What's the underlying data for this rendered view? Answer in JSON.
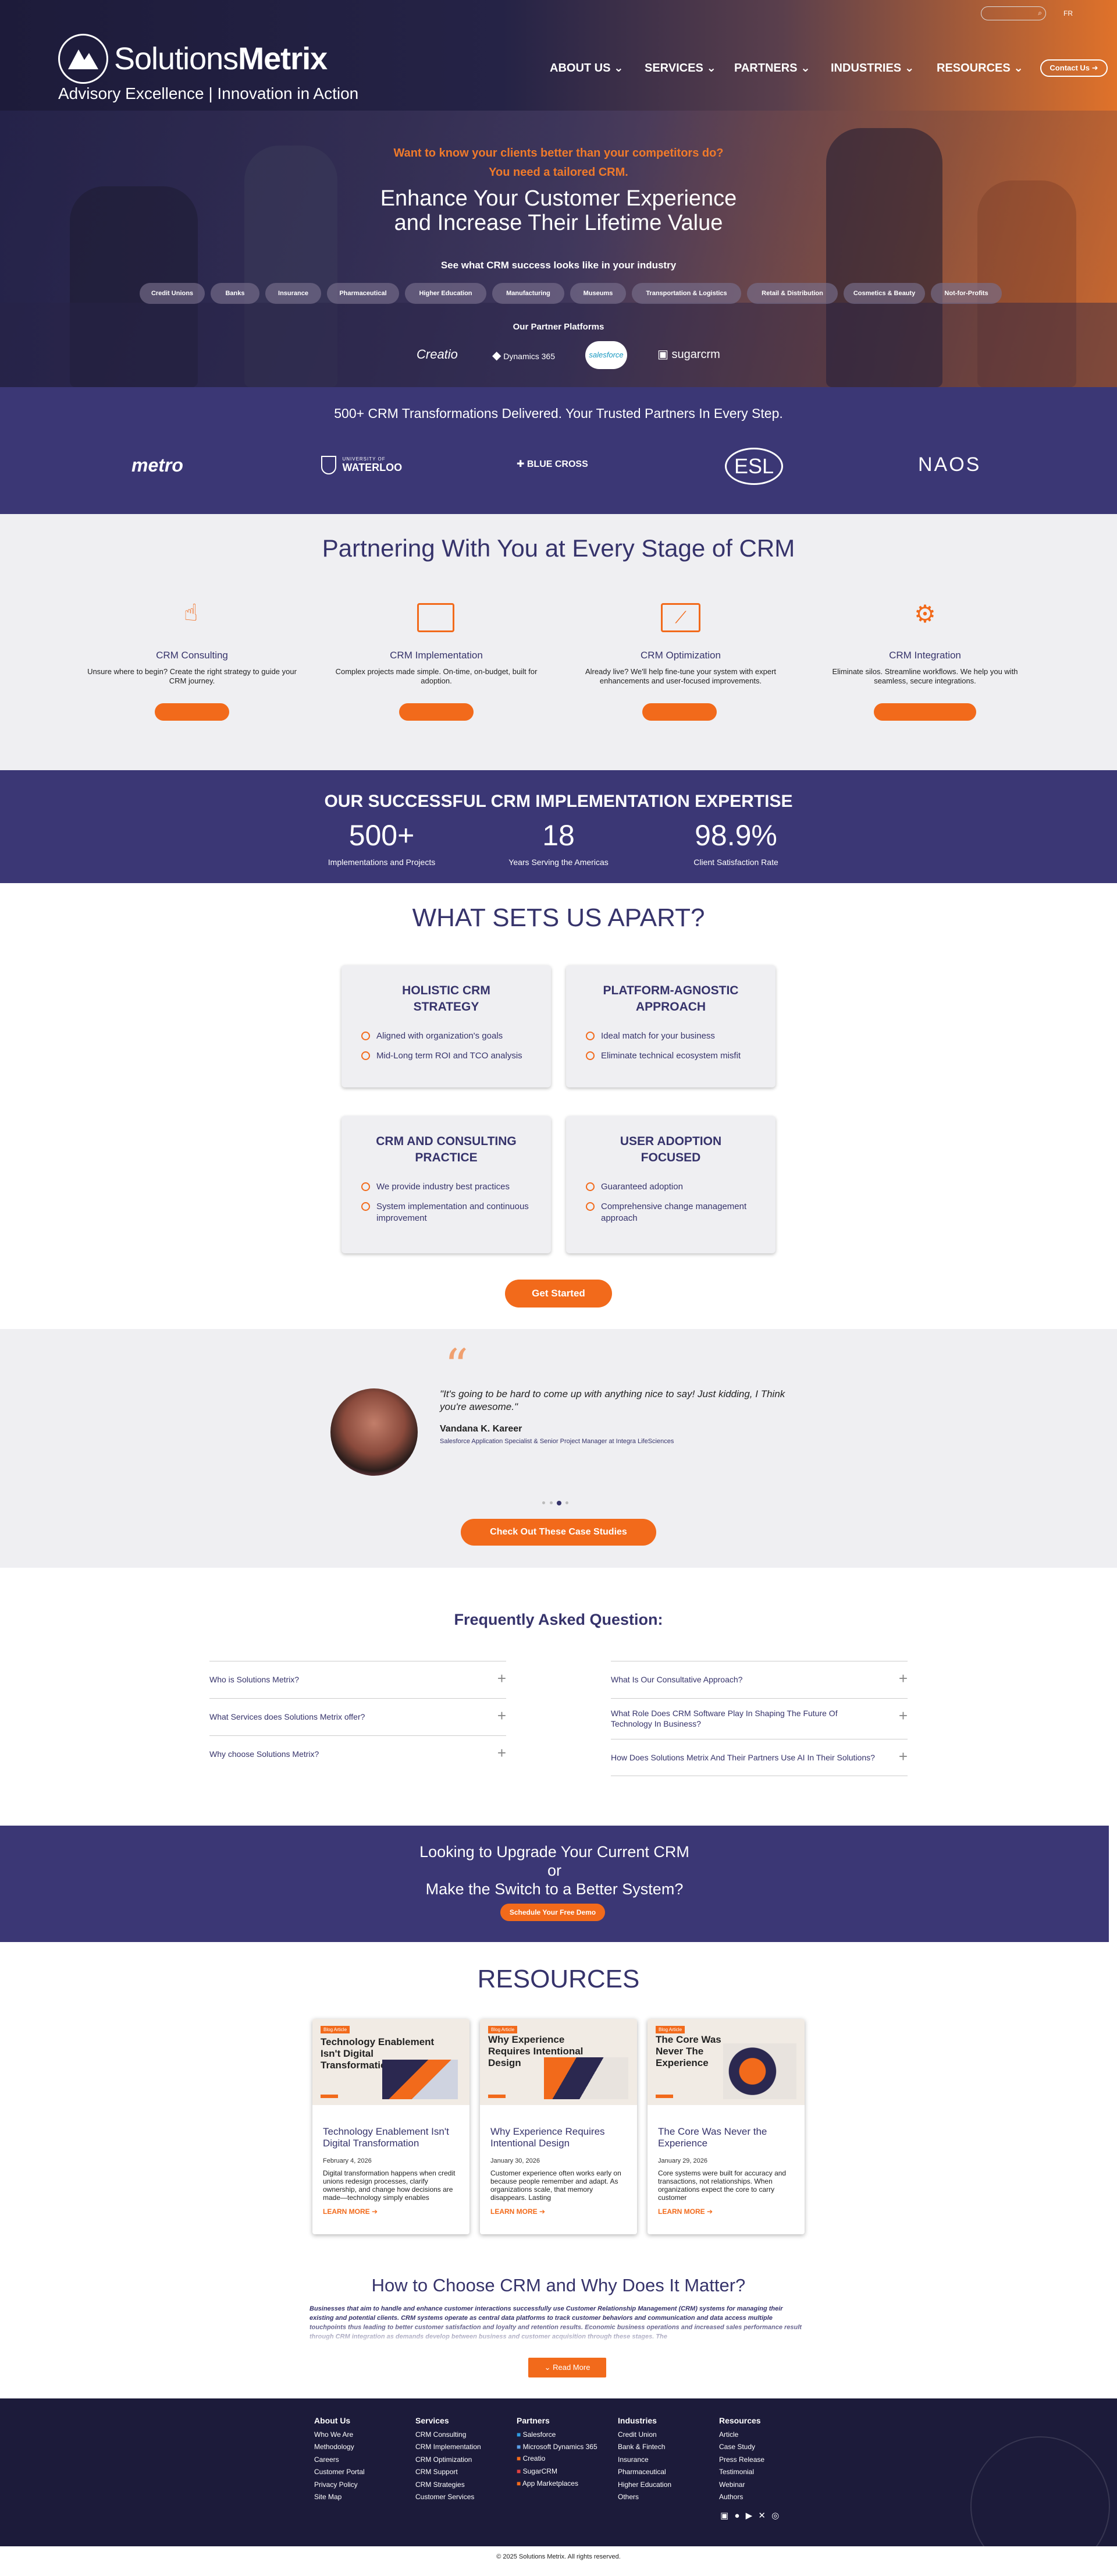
{
  "header": {
    "logo_light": "Solutions",
    "logo_bold": "Metrix",
    "tagline": "Advisory Excellence | Innovation in Action",
    "lang": "FR",
    "nav": [
      "ABOUT US",
      "SERVICES",
      "PARTNERS",
      "INDUSTRIES",
      "RESOURCES"
    ],
    "contact_label": "Contact Us"
  },
  "hero": {
    "question": "Want to know your clients better than your competitors do?",
    "need": "You need a tailored CRM.",
    "title_line1": "Enhance Your Customer Experience",
    "title_line2": "and Increase Their Lifetime Value",
    "industry_prompt": "See what CRM success looks like in your industry",
    "industries": [
      "Credit Unions",
      "Banks",
      "Insurance",
      "Pharmaceutical",
      "Higher Education",
      "Manufacturing",
      "Museums",
      "Transportation & Logistics",
      "Retail & Distribution",
      "Cosmetics & Beauty",
      "Not-for-Profits"
    ],
    "partners_label": "Our Partner Platforms",
    "partners": [
      "Creatio",
      "Dynamics 365",
      "salesforce",
      "sugarcrm"
    ]
  },
  "trusted": {
    "title": "500+ CRM Transformations Delivered. Your Trusted Partners In Every Step.",
    "logos": [
      "metro",
      "UNIVERSITY OF",
      "WATERLOO",
      "BLUE CROSS",
      "ESL",
      "NAOS"
    ]
  },
  "stages": {
    "title": "Partnering With You at Every Stage of CRM",
    "items": [
      {
        "title": "CRM Consulting",
        "text": "Unsure where to begin? Create the right strategy to guide your CRM journey."
      },
      {
        "title": "CRM Implementation",
        "text": "Complex projects made simple. On-time, on-budget, built for adoption."
      },
      {
        "title": "CRM Optimization",
        "text": "Already live? We'll help fine-tune your system with expert enhancements and user-focused improvements."
      },
      {
        "title": "CRM Integration",
        "text": "Eliminate silos. Streamline workflows. We help you with seamless, secure integrations."
      }
    ]
  },
  "expertise": {
    "title": "OUR SUCCESSFUL CRM IMPLEMENTATION EXPERTISE",
    "stats": [
      {
        "value": "500+",
        "label": "Implementations and Projects"
      },
      {
        "value": "18",
        "label": "Years Serving the Americas"
      },
      {
        "value": "98.9%",
        "label": "Client Satisfaction Rate"
      }
    ]
  },
  "apart": {
    "title": "WHAT SETS US APART?",
    "cards": [
      {
        "title": "HOLISTIC CRM STRATEGY",
        "points": [
          "Aligned with organization's goals",
          "Mid-Long term ROI and TCO analysis"
        ]
      },
      {
        "title": "PLATFORM-AGNOSTIC APPROACH",
        "points": [
          "Ideal match for your business",
          "Eliminate technical ecosystem misfit"
        ]
      },
      {
        "title": "CRM AND CONSULTING PRACTICE",
        "points": [
          "We provide industry best practices",
          "System implementation and continuous improvement"
        ]
      },
      {
        "title": "USER ADOPTION FOCUSED",
        "points": [
          "Guaranteed adoption",
          "Comprehensive change management approach"
        ]
      }
    ],
    "cta": "Get Started"
  },
  "testimonial": {
    "quote": "\"It's going to be hard to come up with anything nice to say! Just kidding, I Think you're awesome.\"",
    "name": "Vandana K. Kareer",
    "role": "Salesforce Application Specialist & Senior Project Manager at Integra LifeSciences",
    "cta": "Check Out These Case Studies"
  },
  "faq": {
    "title": "Frequently Asked Question:",
    "left": [
      "Who is Solutions Metrix?",
      "What Services does Solutions Metrix offer?",
      "Why choose Solutions Metrix?"
    ],
    "right": [
      "What Is Our Consultative Approach?",
      "What Role Does CRM Software Play In Shaping The Future Of Technology In Business?",
      "How Does Solutions Metrix And Their Partners Use AI In Their Solutions?"
    ]
  },
  "upgrade": {
    "line1": "Looking to Upgrade Your Current CRM",
    "line2": "or",
    "line3": "Make the Switch to a Better System?",
    "cta": "Schedule Your Free Demo"
  },
  "resources": {
    "title": "RESOURCES",
    "items": [
      {
        "tag": "Blog Article",
        "image_title": "Technology Enablement Isn't Digital Transformation",
        "title": "Technology Enablement Isn't Digital Transformation",
        "date": "February 4, 2026",
        "excerpt": "Digital transformation happens when credit unions redesign processes, clarify ownership, and change how decisions are made—technology simply enables",
        "link": "LEARN MORE"
      },
      {
        "tag": "Blog Article",
        "image_title": "Why Experience Requires Intentional Design",
        "title": "Why Experience Requires Intentional Design",
        "date": "January 30, 2026",
        "excerpt": "Customer experience often works early on because people remember and adapt. As organizations scale, that memory disappears. Lasting",
        "link": "LEARN MORE"
      },
      {
        "tag": "Blog Article",
        "image_title": "The Core Was Never The Experience",
        "title": "The Core Was Never the Experience",
        "date": "January 29, 2026",
        "excerpt": "Core systems were built for accuracy and transactions, not relationships. When organizations expect the core to carry customer",
        "link": "LEARN MORE"
      }
    ]
  },
  "howto": {
    "title": "How to Choose CRM and Why Does It Matter?",
    "text": "Businesses that aim to handle and enhance customer interactions successfully use Customer Relationship Management (CRM) systems for managing their existing and potential clients. CRM systems operate as central data platforms to track customer behaviors and communication and data access multiple touchpoints thus leading to better customer satisfaction and loyalty and retention results. Economic business operations and increased sales performance result through CRM integration as demands develop between business and customer acquisition through these stages. The",
    "cta": "Read More"
  },
  "footer": {
    "columns": [
      {
        "title": "About Us",
        "links": [
          "Who We Are",
          "Methodology",
          "Careers",
          "Customer Portal",
          "Privacy Policy",
          "Site Map"
        ]
      },
      {
        "title": "Services",
        "links": [
          "CRM Consulting",
          "CRM Implementation",
          "CRM Optimization",
          "CRM Support",
          "CRM Strategies",
          "Customer Services"
        ]
      },
      {
        "title": "Partners",
        "links": [
          "Salesforce",
          "Microsoft Dynamics 365",
          "Creatio",
          "SugarCRM",
          "App Marketplaces"
        ]
      },
      {
        "title": "Industries",
        "links": [
          "Credit Union",
          "Bank & Fintech",
          "Insurance",
          "Pharmaceutical",
          "Higher Education",
          "Others"
        ]
      },
      {
        "title": "Resources",
        "links": [
          "Article",
          "Case Study",
          "Press Release",
          "Testimonial",
          "Webinar",
          "Authors"
        ]
      }
    ],
    "copyright": "© 2025 Solutions Metrix. All rights reserved."
  },
  "colors": {
    "navy": "#36336b",
    "band": "#3b3775",
    "orange": "#f26a1b",
    "footer": "#1c1b3a"
  }
}
